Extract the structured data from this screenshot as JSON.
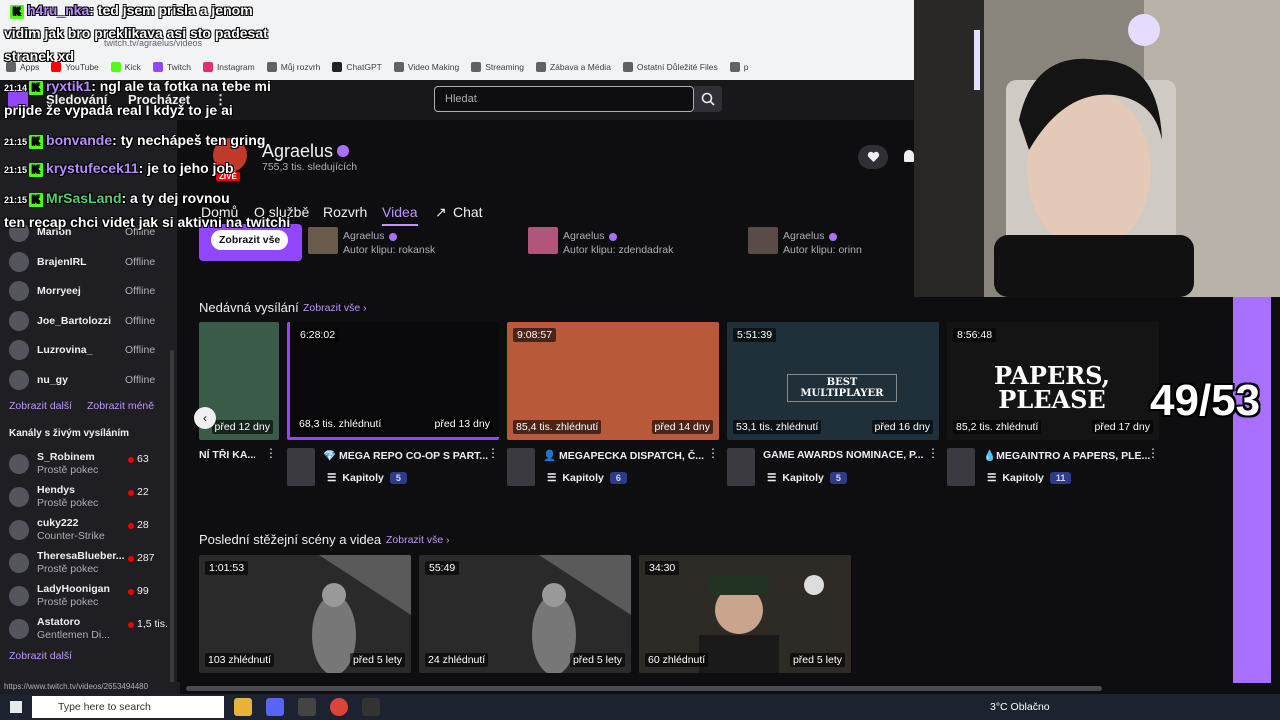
{
  "browser": {
    "url": "twitch.tv/agraelus/videos",
    "bookmarks": [
      {
        "label": "Apps",
        "color": "#5f6368"
      },
      {
        "label": "YouTube",
        "color": "#ff0000"
      },
      {
        "label": "Kick",
        "color": "#53fc18"
      },
      {
        "label": "Twitch",
        "color": "#9147ff"
      },
      {
        "label": "Instagram",
        "color": "#e1306c"
      },
      {
        "label": "Můj rozvrh",
        "color": "#5f6368"
      },
      {
        "label": "ChatGPT",
        "color": "#222222"
      },
      {
        "label": "Video Making",
        "color": "#5f6368"
      },
      {
        "label": "Streaming",
        "color": "#5f6368"
      },
      {
        "label": "Zábava a Média",
        "color": "#5f6368"
      },
      {
        "label": "Ostatní Důležité Files",
        "color": "#5f6368"
      },
      {
        "label": "p",
        "color": "#5f6368"
      }
    ]
  },
  "topnav": {
    "following": "Sledování",
    "browse": "Procházet",
    "more": "⋮",
    "search_placeholder": "Hledat"
  },
  "channel": {
    "name": "Agraelus",
    "followers": "755,3 tis. sledujících",
    "live_badge": "ŽIVĚ",
    "tabs": [
      "Domů",
      "O službě",
      "Rozvrh",
      "Videa",
      "Chat"
    ],
    "active_tab": "Videa",
    "show_all_button": "Zobrazit vše"
  },
  "clips": [
    {
      "channel": "Agraelus",
      "author": "Autor klipu: rokansk",
      "color": "#6a5a4a"
    },
    {
      "channel": "Agraelus",
      "author": "Autor klipu: zdendadrak",
      "color": "#b0567a"
    },
    {
      "channel": "Agraelus",
      "author": "Autor klipu: orinn",
      "color": "#5a4a48"
    }
  ],
  "recent": {
    "title": "Nedávná vysílání",
    "link": "Zobrazit vše ›",
    "videos": [
      {
        "duration": "",
        "views": "",
        "ago": "před 12 dny",
        "title": "NÍ TŘI KA...",
        "chapters": "",
        "count": "",
        "bg": "#3a5a4a"
      },
      {
        "duration": "6:28:02",
        "views": "68,3 tis. zhlédnutí",
        "ago": "před 13 dny",
        "title": "💎 MEGA REPO CO-OP S PART...",
        "chapters": "Kapitoly",
        "count": "5",
        "bg": "#0a0a0c"
      },
      {
        "duration": "9:08:57",
        "views": "85,4 tis. zhlédnutí",
        "ago": "před 14 dny",
        "title": "👤 MEGAPECKA DISPATCH, Č...",
        "chapters": "Kapitoly",
        "count": "6",
        "bg": "#b85a3a"
      },
      {
        "duration": "5:51:39",
        "views": "53,1 tis. zhlédnutí",
        "ago": "před 16 dny",
        "title": "GAME AWARDS NOMINACE, P...",
        "chapters": "Kapitoly",
        "count": "5",
        "bg": "#20303a",
        "overlay": "BEST MULTIPLAYER"
      },
      {
        "duration": "8:56:48",
        "views": "85,2 tis. zhlédnutí",
        "ago": "před 17 dny",
        "title": "💧MEGAINTRO A PAPERS, PLE...",
        "chapters": "Kapitoly",
        "count": "11",
        "bg": "#141414",
        "overlay": "PAPERS, PLEASE"
      }
    ]
  },
  "highlights": {
    "title": "Poslední stěžejní scény a videa",
    "link": "Zobrazit vše ›",
    "videos": [
      {
        "duration": "1:01:53",
        "views": "103 zhlédnutí",
        "ago": "před 5 lety",
        "bg": "#2a2a2a"
      },
      {
        "duration": "55:49",
        "views": "24 zhlédnutí",
        "ago": "před 5 lety",
        "bg": "#2a2a2a"
      },
      {
        "duration": "34:30",
        "views": "60 zhlédnutí",
        "ago": "před 5 lety",
        "bg": "#3a3530"
      }
    ]
  },
  "sidebar": {
    "offline": [
      {
        "name": "Marion",
        "status": "Offline"
      },
      {
        "name": "BrajenIRL",
        "status": "Offline"
      },
      {
        "name": "Morryeej",
        "status": "Offline"
      },
      {
        "name": "Joe_Bartolozzi",
        "status": "Offline"
      },
      {
        "name": "Luzrovina_",
        "status": "Offline"
      },
      {
        "name": "nu_gy",
        "status": "Offline"
      }
    ],
    "show_more": "Zobrazit další",
    "show_less": "Zobrazit méně",
    "live_heading": "Kanály s živým vysíláním",
    "live": [
      {
        "name": "S_Robinem",
        "game": "Prostě pokec",
        "viewers": "63"
      },
      {
        "name": "Hendys",
        "game": "Prostě pokec",
        "viewers": "22"
      },
      {
        "name": "cuky222",
        "game": "Counter-Strike",
        "viewers": "28"
      },
      {
        "name": "TheresaBlueber...",
        "game": "Prostě pokec",
        "viewers": "287"
      },
      {
        "name": "LadyHoonigan",
        "game": "Prostě pokec",
        "viewers": "99"
      },
      {
        "name": "Astatoro",
        "game": "Gentlemen Di...",
        "viewers": "1,5 tis."
      }
    ],
    "show_more_2": "Zobrazit další"
  },
  "chat": [
    {
      "user": "h4ru_nka",
      "text": ": ted jsem prisla a jenom",
      "cont": "vidim jak bro preklikava asi sto padesat",
      "cont2": "stranek xd",
      "color": "purple"
    },
    {
      "time": "21:14",
      "user": "ryxtik1",
      "text": ": ngl ale ta fotka na tebe mi",
      "cont": "prijde že vypadá real I když to je ai",
      "color": "purple"
    },
    {
      "time": "21:15",
      "user": "bonvande",
      "text": ": ty nechápeš ten gring",
      "color": "purple"
    },
    {
      "time": "21:15",
      "user": "krystufecek11",
      "text": ": je to jeho job",
      "color": "purple"
    },
    {
      "time": "21:15",
      "user": "MrSasLand",
      "text": ": a ty dej rovnou",
      "cont": "ten recap chci videt jak si aktivni na twitchi",
      "color": "green"
    }
  ],
  "counter": "49/53",
  "status_url": "https://www.twitch.tv/videos/2653494480",
  "taskbar": {
    "search": "Type here to search",
    "weather": "3°C Oblačno"
  }
}
